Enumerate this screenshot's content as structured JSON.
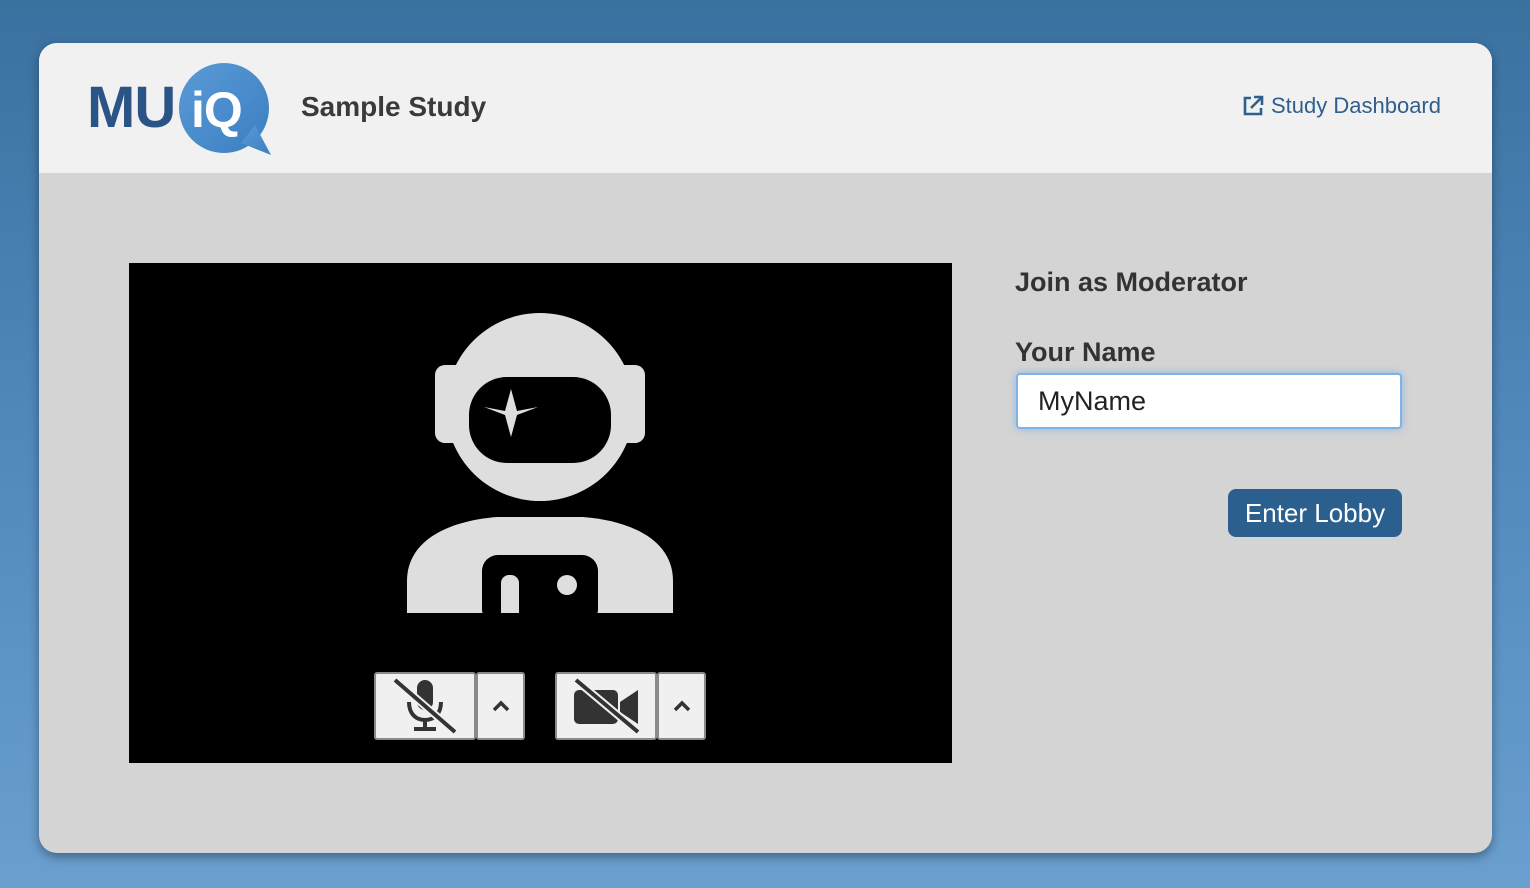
{
  "header": {
    "logo_mu": "MU",
    "logo_iq": "iQ",
    "study_title": "Sample Study",
    "dashboard_link": "Study Dashboard"
  },
  "video": {
    "icons": {
      "avatar": "astronaut-avatar-icon",
      "mic": "microphone-off-icon",
      "camera": "camera-off-icon",
      "caret": "chevron-up-icon"
    }
  },
  "join": {
    "title": "Join as Moderator",
    "name_label": "Your Name",
    "name_value": "MyName",
    "enter_button": "Enter Lobby"
  },
  "colors": {
    "background": "#4f87bb",
    "brand_dark": "#2b5486",
    "brand_light": "#4a8ccc",
    "button": "#2a5f8e",
    "link": "#2f5f8c"
  }
}
